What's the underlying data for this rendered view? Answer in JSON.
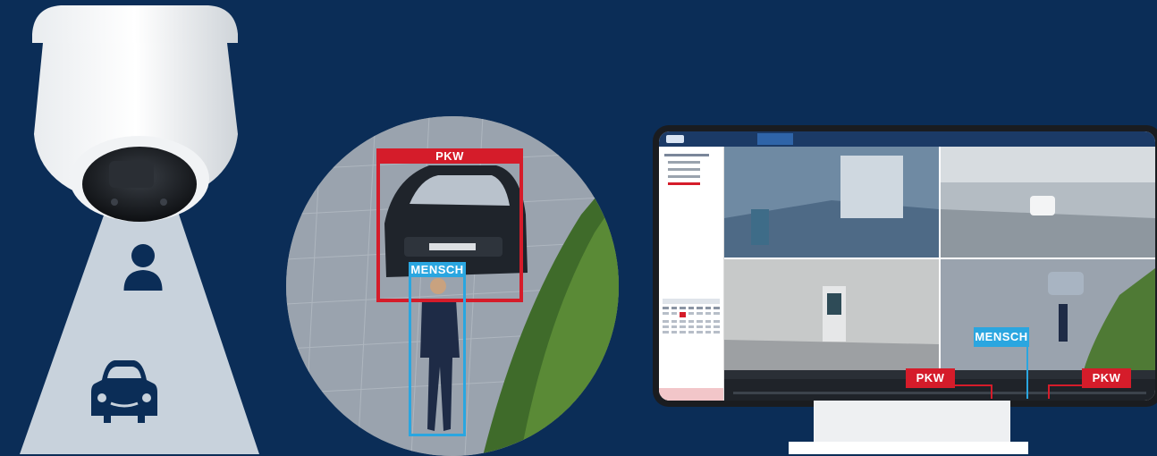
{
  "detection": {
    "car_label": "PKW",
    "person_label": "MENSCH"
  },
  "nvr_ui": {
    "labels": {
      "car_left": "PKW",
      "car_right": "PKW",
      "person": "MENSCH"
    }
  },
  "icons": [
    "dome-camera-icon",
    "person-icon",
    "car-icon"
  ],
  "colors": {
    "background": "#0b2d57",
    "car_box": "#d51c2a",
    "person_box": "#2aa6e0",
    "cone": "#c8d2dc"
  }
}
